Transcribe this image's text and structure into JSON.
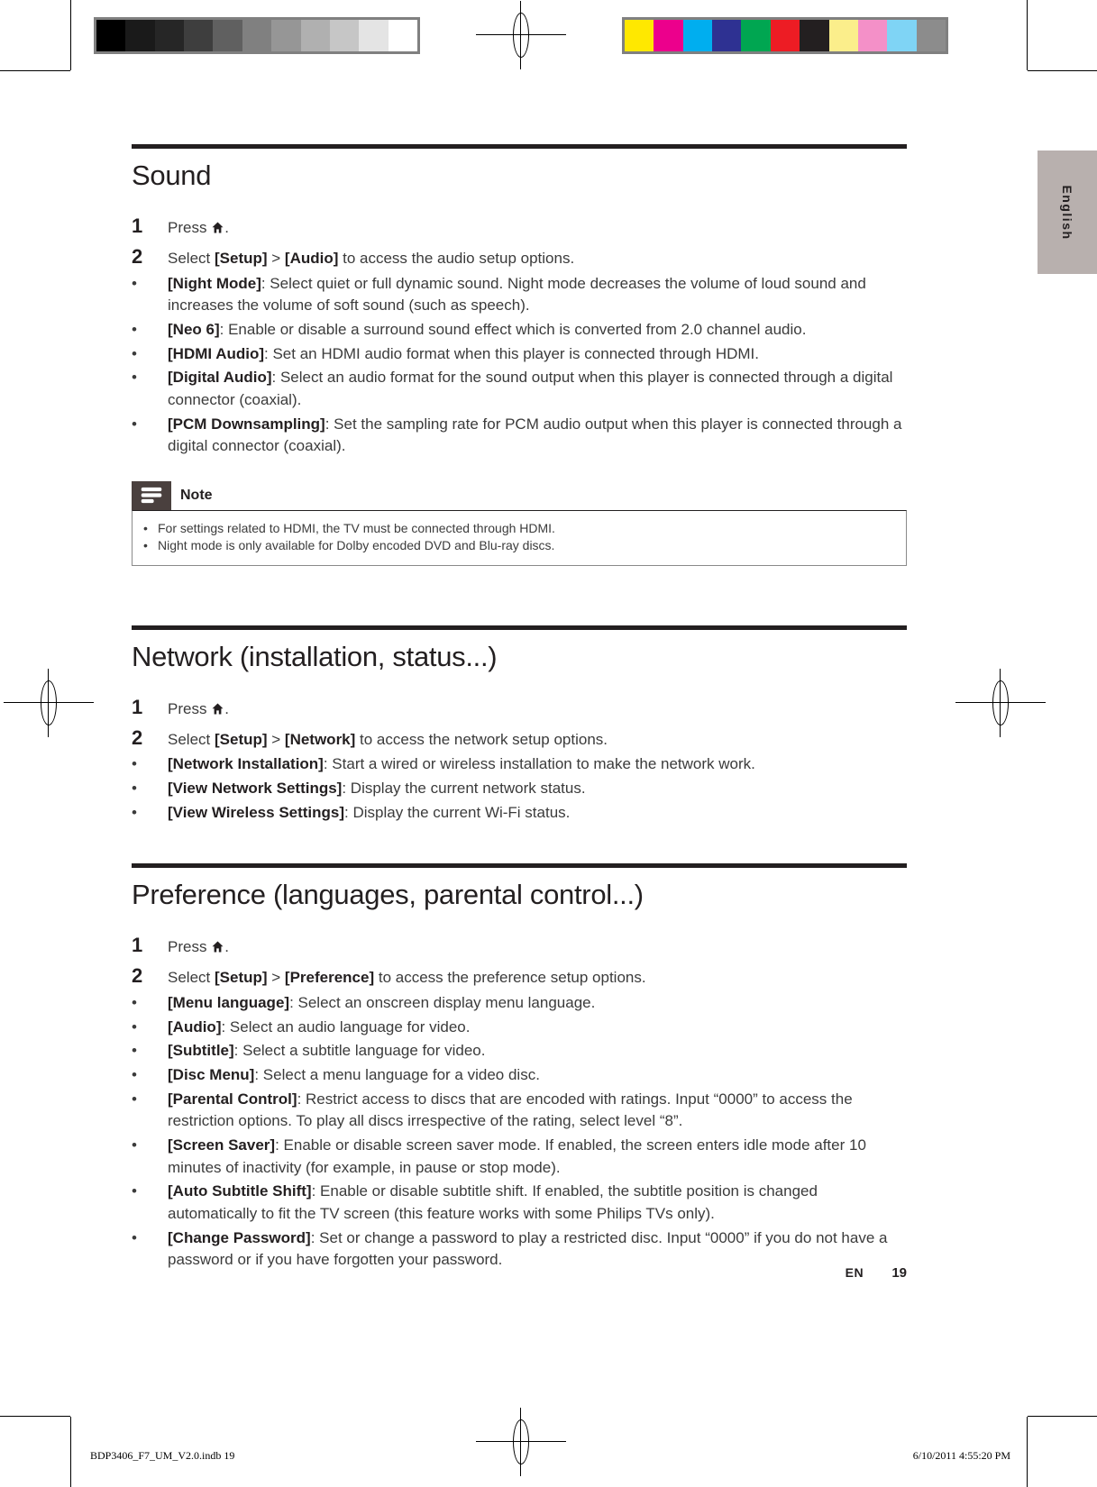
{
  "page": {
    "language_tab": "English",
    "footer_marker": "EN",
    "footer_page_number": "19",
    "imprint_left": "BDP3406_F7_UM_V2.0.indb   19",
    "imprint_right": "6/10/2011   4:55:20 PM"
  },
  "calibration": {
    "grayscale": [
      "#000000",
      "#1a1a1a",
      "#262626",
      "#3e3e3e",
      "#606060",
      "#808080",
      "#969696",
      "#b0b0b0",
      "#c6c6c6",
      "#e4e4e4",
      "#ffffff"
    ],
    "color": [
      "#ffe800",
      "#ec008c",
      "#00aeef",
      "#2e3192",
      "#00a651",
      "#ed1c24",
      "#231f20",
      "#fbee8b",
      "#f490c8",
      "#7fd4f5",
      "#8c8c8c"
    ]
  },
  "sections": [
    {
      "id": "sound",
      "title": "Sound",
      "steps": [
        {
          "num": "1",
          "pre": "Press ",
          "icon": "home-icon",
          "post": "."
        },
        {
          "num": "2",
          "html_parts": [
            {
              "t": "Select "
            },
            {
              "t": "[Setup]",
              "bold": true
            },
            {
              "t": " > "
            },
            {
              "t": "[Audio]",
              "bold": true
            },
            {
              "t": " to access the audio setup options."
            }
          ]
        }
      ],
      "bullets": [
        {
          "term": "[Night Mode]",
          "desc": ": Select quiet or full dynamic sound. Night mode decreases the volume of loud sound and increases the volume of soft sound (such as speech)."
        },
        {
          "term": "[Neo 6]",
          "desc": ": Enable or disable a surround sound effect which is converted from 2.0 channel audio."
        },
        {
          "term": "[HDMI Audio]",
          "desc": ": Set an HDMI audio format when this player is connected through HDMI."
        },
        {
          "term": "[Digital Audio]",
          "desc": ": Select an audio format for the sound output when this player is connected through a digital connector (coaxial)."
        },
        {
          "term": "[PCM Downsampling]",
          "desc": ": Set the sampling rate for PCM audio output when this player is connected through a digital connector (coaxial)."
        }
      ],
      "note": {
        "title": "Note",
        "lines": [
          "For settings related to HDMI, the TV must be connected through HDMI.",
          "Night mode is only available for Dolby encoded DVD and Blu-ray discs."
        ]
      }
    },
    {
      "id": "network",
      "title": "Network (installation, status...)",
      "steps": [
        {
          "num": "1",
          "pre": "Press ",
          "icon": "home-icon",
          "post": "."
        },
        {
          "num": "2",
          "html_parts": [
            {
              "t": "Select "
            },
            {
              "t": "[Setup]",
              "bold": true
            },
            {
              "t": " > "
            },
            {
              "t": "[Network]",
              "bold": true
            },
            {
              "t": " to access the network setup options."
            }
          ]
        }
      ],
      "bullets": [
        {
          "term": "[Network Installation]",
          "desc": ": Start a wired or wireless installation to make the network work."
        },
        {
          "term": "[View Network Settings]",
          "desc": ": Display the current network status."
        },
        {
          "term": "[View Wireless Settings]",
          "desc": ": Display the current Wi-Fi status."
        }
      ]
    },
    {
      "id": "preference",
      "title": "Preference (languages, parental control...)",
      "steps": [
        {
          "num": "1",
          "pre": "Press ",
          "icon": "home-icon",
          "post": "."
        },
        {
          "num": "2",
          "html_parts": [
            {
              "t": "Select "
            },
            {
              "t": "[Setup]",
              "bold": true
            },
            {
              "t": " > "
            },
            {
              "t": "[Preference]",
              "bold": true
            },
            {
              "t": " to access the preference setup options."
            }
          ]
        }
      ],
      "bullets": [
        {
          "term": "[Menu language]",
          "desc": ": Select an onscreen display menu language."
        },
        {
          "term": "[Audio]",
          "desc": ": Select an audio language for video."
        },
        {
          "term": "[Subtitle]",
          "desc": ": Select a subtitle language for video."
        },
        {
          "term": "[Disc Menu]",
          "desc": ": Select a menu language for a video disc."
        },
        {
          "term": "[Parental Control]",
          "desc": ": Restrict access to discs that are encoded with ratings. Input “0000” to access the restriction options. To play all discs irrespective of the rating, select level “8”."
        },
        {
          "term": "[Screen Saver]",
          "desc": ": Enable or disable screen saver mode. If enabled, the screen enters idle mode after 10 minutes of inactivity (for example, in pause or stop mode)."
        },
        {
          "term": "[Auto Subtitle Shift]",
          "desc": ": Enable or disable subtitle shift. If enabled, the subtitle position is changed automatically to fit the TV screen (this feature works with some Philips TVs only)."
        },
        {
          "term": "[Change Password]",
          "desc": ": Set or change a password to play a restricted disc. Input “0000” if you do not have a password or if you have forgotten your password."
        }
      ]
    }
  ],
  "bullet_glyph": "•"
}
